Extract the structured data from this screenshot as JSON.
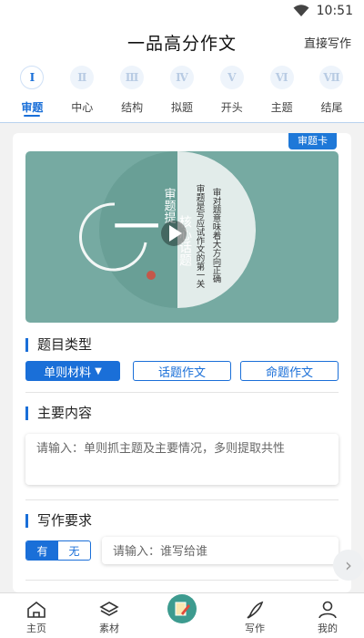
{
  "status": {
    "time": "10:51"
  },
  "header": {
    "title": "一品高分作文",
    "action": "直接写作"
  },
  "steps": [
    {
      "numeral": "Ⅰ",
      "label": "审题"
    },
    {
      "numeral": "Ⅱ",
      "label": "中心"
    },
    {
      "numeral": "Ⅲ",
      "label": "结构"
    },
    {
      "numeral": "Ⅳ",
      "label": "拟题"
    },
    {
      "numeral": "Ⅴ",
      "label": "开头"
    },
    {
      "numeral": "Ⅵ",
      "label": "主题"
    },
    {
      "numeral": "Ⅶ",
      "label": "结尾"
    }
  ],
  "card": {
    "tag": "审题卡",
    "banner": {
      "big_char": "一",
      "col1": "审题提",
      "col2": "核心话题",
      "col3": "审题是写应试作文的第一关",
      "col4": "审对题意味着大方向正确",
      "colors": {
        "bg": "#76aaa2",
        "disc": "#e2ecea"
      }
    },
    "type_section": {
      "title": "题目类型",
      "options": [
        "单则材料",
        "话题作文",
        "命题作文"
      ],
      "selected_index": 0
    },
    "content_section": {
      "title": "主要内容",
      "placeholder": "请输入：单则抓主题及主要情况，多则提取共性"
    },
    "requirement_section": {
      "title": "写作要求",
      "toggle_on": "有",
      "toggle_off": "无",
      "toggle_value": "有",
      "placeholder": "请输入：谁写给谁"
    }
  },
  "tabbar": [
    {
      "label": "主页",
      "icon": "home-icon"
    },
    {
      "label": "素材",
      "icon": "layers-icon"
    },
    {
      "label": "",
      "icon": "edit-icon"
    },
    {
      "label": "写作",
      "icon": "pen-icon"
    },
    {
      "label": "我的",
      "icon": "user-icon"
    }
  ],
  "colors": {
    "accent": "#1a6fd8",
    "tag": "#1e78d8"
  }
}
